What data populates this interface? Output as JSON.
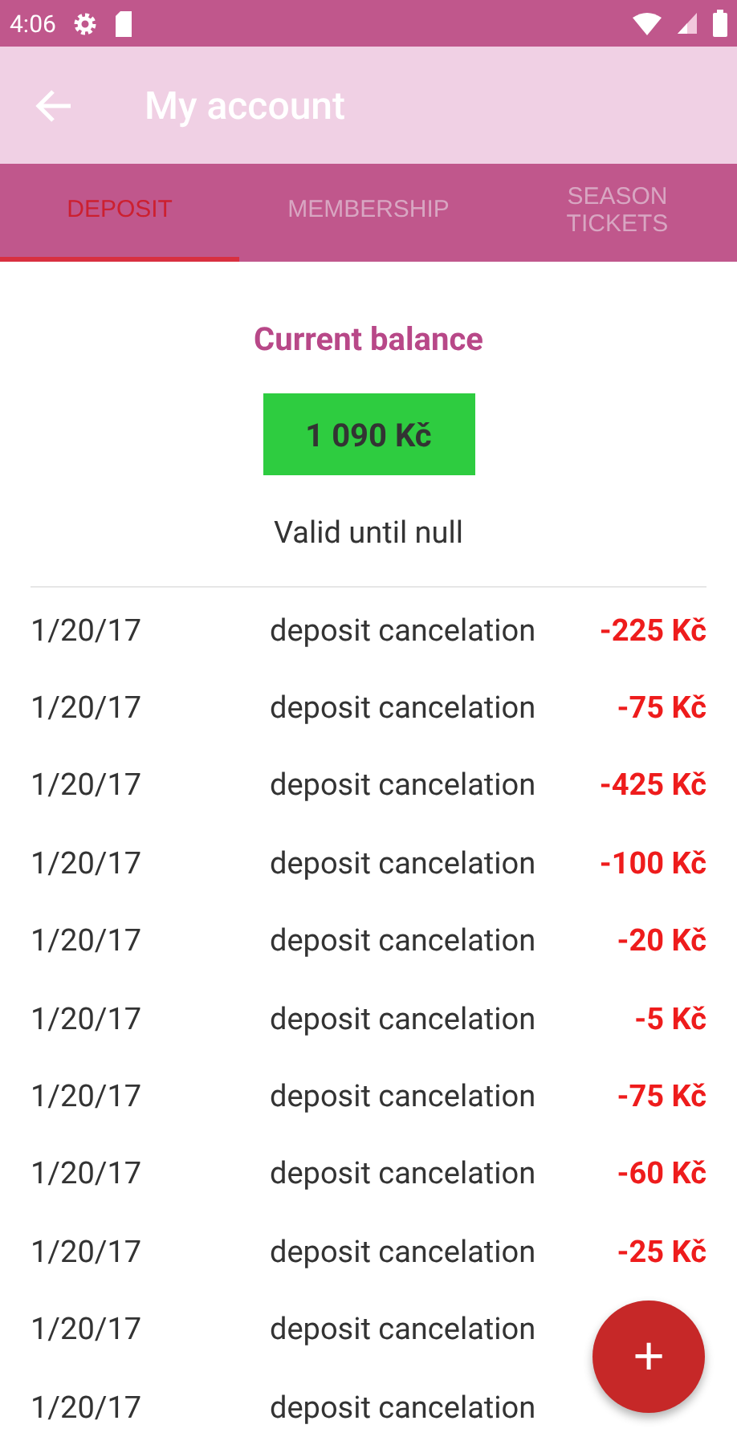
{
  "status_bar": {
    "time": "4:06"
  },
  "toolbar": {
    "title": "My account"
  },
  "tabs": [
    {
      "label": "DEPOSIT",
      "selected": true
    },
    {
      "label": "MEMBERSHIP",
      "selected": false
    },
    {
      "label": "SEASON TICKETS",
      "selected": false
    }
  ],
  "balance": {
    "heading": "Current balance",
    "amount": "1 090 Kč",
    "valid": "Valid until null"
  },
  "transactions": [
    {
      "date": "1/20/17",
      "description": "deposit cancelation",
      "amount": "-225 Kč"
    },
    {
      "date": "1/20/17",
      "description": "deposit cancelation",
      "amount": "-75 Kč"
    },
    {
      "date": "1/20/17",
      "description": "deposit cancelation",
      "amount": "-425 Kč"
    },
    {
      "date": "1/20/17",
      "description": "deposit cancelation",
      "amount": "-100 Kč"
    },
    {
      "date": "1/20/17",
      "description": "deposit cancelation",
      "amount": "-20 Kč"
    },
    {
      "date": "1/20/17",
      "description": "deposit cancelation",
      "amount": "-5 Kč"
    },
    {
      "date": "1/20/17",
      "description": "deposit cancelation",
      "amount": "-75 Kč"
    },
    {
      "date": "1/20/17",
      "description": "deposit cancelation",
      "amount": "-60 Kč"
    },
    {
      "date": "1/20/17",
      "description": "deposit cancelation",
      "amount": "-25 Kč"
    },
    {
      "date": "1/20/17",
      "description": "deposit cancelation"
    },
    {
      "date": "1/20/17",
      "description": "deposit cancelation"
    }
  ],
  "fab": {
    "label": "+"
  }
}
